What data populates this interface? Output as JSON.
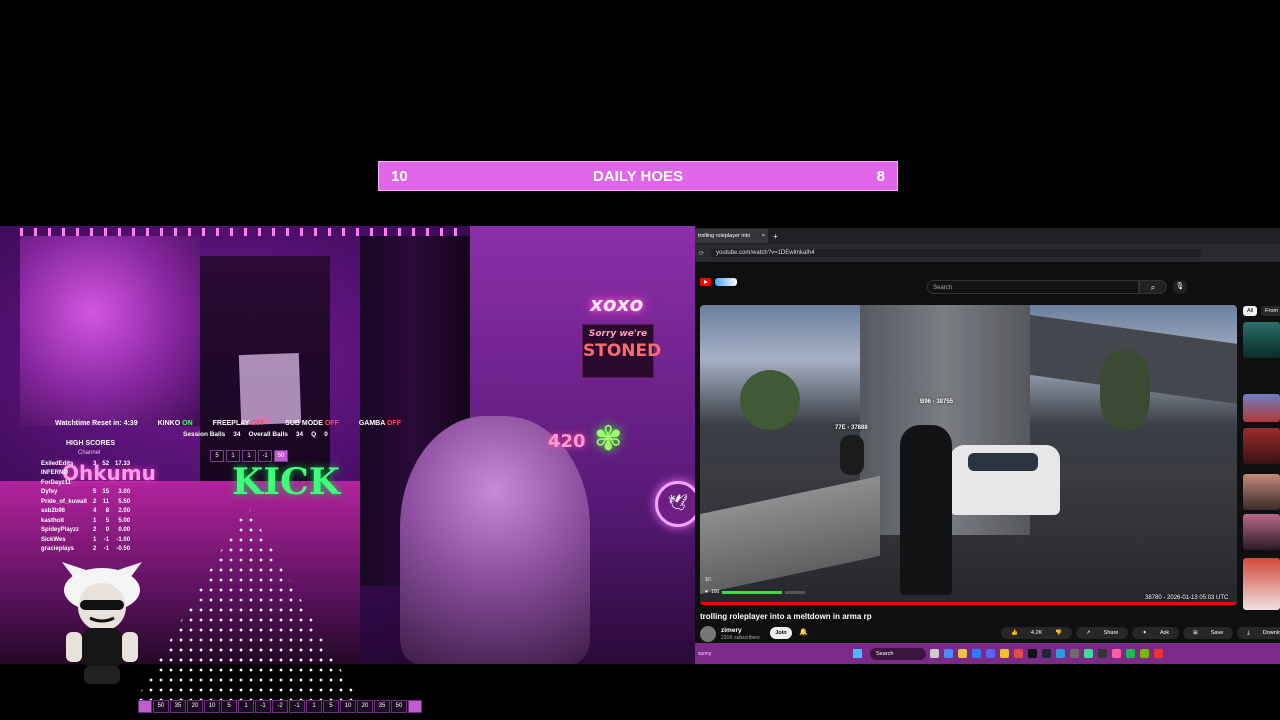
{
  "banner": {
    "left_score": "10",
    "title": "DAILY HOES",
    "right_score": "8"
  },
  "stream": {
    "neon_xoxo": "xoxo",
    "neon_sorry": "Sorry we're",
    "neon_stoned": "STONED",
    "neon_420": "420",
    "neon_kick": "KICK",
    "neon_name": "Ohkumu",
    "badge": "🕊",
    "watch_row": {
      "watchtime": "Watchtime Reset in: 4:39",
      "kinko": "KINKO",
      "kinko_state": "ON",
      "freeplay": "FREEPLAY",
      "freeplay_state": "OFF",
      "submode": "SUB MODE",
      "submode_state": "OFF",
      "gamba": "GAMBA",
      "gamba_state": "OFF"
    },
    "session_row": {
      "session_label": "Session Balls",
      "session_val": "34",
      "overall_label": "Overall Balls",
      "overall_val": "34",
      "q_label": "Q",
      "q_val": "0"
    },
    "mini_nums": [
      "5",
      "1",
      "1",
      "-1",
      "50"
    ],
    "high_scores": {
      "title": "HIGH SCORES",
      "subtitle": "Channel",
      "rows": [
        {
          "name": "ExiledEdits",
          "a": "3",
          "b": "52",
          "c": "17.33"
        },
        {
          "name": "INFERNO",
          "a": "",
          "b": "",
          "c": ""
        },
        {
          "name": "ForDayz11",
          "a": "",
          "b": "",
          "c": ""
        },
        {
          "name": "Dyfey",
          "a": "5",
          "b": "15",
          "c": "3.00"
        },
        {
          "name": "Pride_of_kuwait",
          "a": "2",
          "b": "11",
          "c": "5.50"
        },
        {
          "name": "ssb2b96",
          "a": "4",
          "b": "8",
          "c": "2.00"
        },
        {
          "name": "kasthoit",
          "a": "1",
          "b": "5",
          "c": "5.00"
        },
        {
          "name": "SpideyPlayzz",
          "a": "2",
          "b": "0",
          "c": "0.00"
        },
        {
          "name": "SickWes",
          "a": "1",
          "b": "-1",
          "c": "-1.00"
        },
        {
          "name": "gracieplays",
          "a": "2",
          "b": "-1",
          "c": "-0.50"
        }
      ]
    },
    "bottom_bar": [
      "50",
      "35",
      "20",
      "10",
      "5",
      "1",
      "-1",
      "-2",
      "-1",
      "1",
      "5",
      "10",
      "20",
      "35",
      "50"
    ]
  },
  "browser": {
    "tab_title": "trolling roleplayer into",
    "new_tab": "+",
    "url": "youtube.com/watch?v=1DEwlmkaIh4",
    "search_placeholder": "Search",
    "search_icon": "search-icon",
    "mic_icon": "mic-icon",
    "chips": [
      "All",
      "From"
    ],
    "video": {
      "tag_1": "77E - 37888",
      "tag_2": "B96 - 38755",
      "hud_cash": "$0",
      "hud_health": "100",
      "time": "38780 - 2026-01-13 05:03 UTC",
      "progress_fraction": 1.0
    },
    "title": "trolling roleplayer into a meltdown in arma rp",
    "channel": "zimery",
    "subs": "231K subscribers",
    "join": "Join",
    "likes": "4.2K",
    "share": "Share",
    "ask": "Ask",
    "save": "Save",
    "download": "Download",
    "more": "···"
  },
  "taskbar": {
    "left_text": "sunny",
    "search": "Search"
  },
  "colors": {
    "banner": "#e066e8",
    "taskbar": "#7c2a88",
    "youtube_red": "#ff0000"
  }
}
